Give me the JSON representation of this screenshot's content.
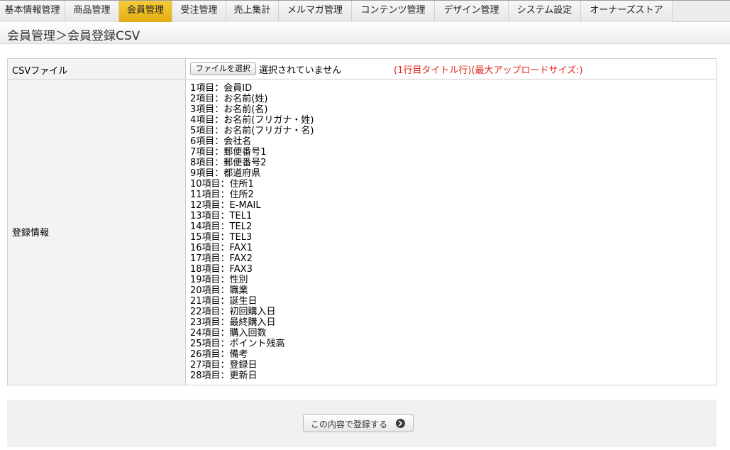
{
  "nav": {
    "tabs": [
      {
        "label": "基本情報管理",
        "active": false
      },
      {
        "label": "商品管理",
        "active": false
      },
      {
        "label": "会員管理",
        "active": true
      },
      {
        "label": "受注管理",
        "active": false
      },
      {
        "label": "売上集計",
        "active": false
      },
      {
        "label": "メルマガ管理",
        "active": false
      },
      {
        "label": "コンテンツ管理",
        "active": false
      },
      {
        "label": "デザイン管理",
        "active": false
      },
      {
        "label": "システム設定",
        "active": false
      },
      {
        "label": "オーナーズストア",
        "active": false
      }
    ],
    "active_color": "#efc027"
  },
  "page": {
    "title": "会員管理＞会員登録CSV"
  },
  "form": {
    "csv_row": {
      "label": "CSVファイル",
      "file_button": "ファイルを選択",
      "file_status": "選択されていません",
      "note": "(1行目タイトル行)(最大アップロードサイズ:)",
      "note_color": "#e0261c"
    },
    "info_row": {
      "label": "登録情報",
      "fields": [
        "1項目：会員ID",
        "2項目：お名前(姓)",
        "3項目：お名前(名)",
        "4項目：お名前(フリガナ・姓)",
        "5項目：お名前(フリガナ・名)",
        "6項目：会社名",
        "7項目：郵便番号1",
        "8項目：郵便番号2",
        "9項目：都道府県",
        "10項目：住所1",
        "11項目：住所2",
        "12項目：E-MAIL",
        "13項目：TEL1",
        "14項目：TEL2",
        "15項目：TEL3",
        "16項目：FAX1",
        "17項目：FAX2",
        "18項目：FAX3",
        "19項目：性別",
        "20項目：職業",
        "21項目：誕生日",
        "22項目：初回購入日",
        "23項目：最終購入日",
        "24項目：購入回数",
        "25項目：ポイント残高",
        "26項目：備考",
        "27項目：登録日",
        "28項目：更新日"
      ]
    }
  },
  "footer": {
    "submit_label": "この内容で登録する",
    "submit_icon": "arrow-right-circle-icon"
  }
}
